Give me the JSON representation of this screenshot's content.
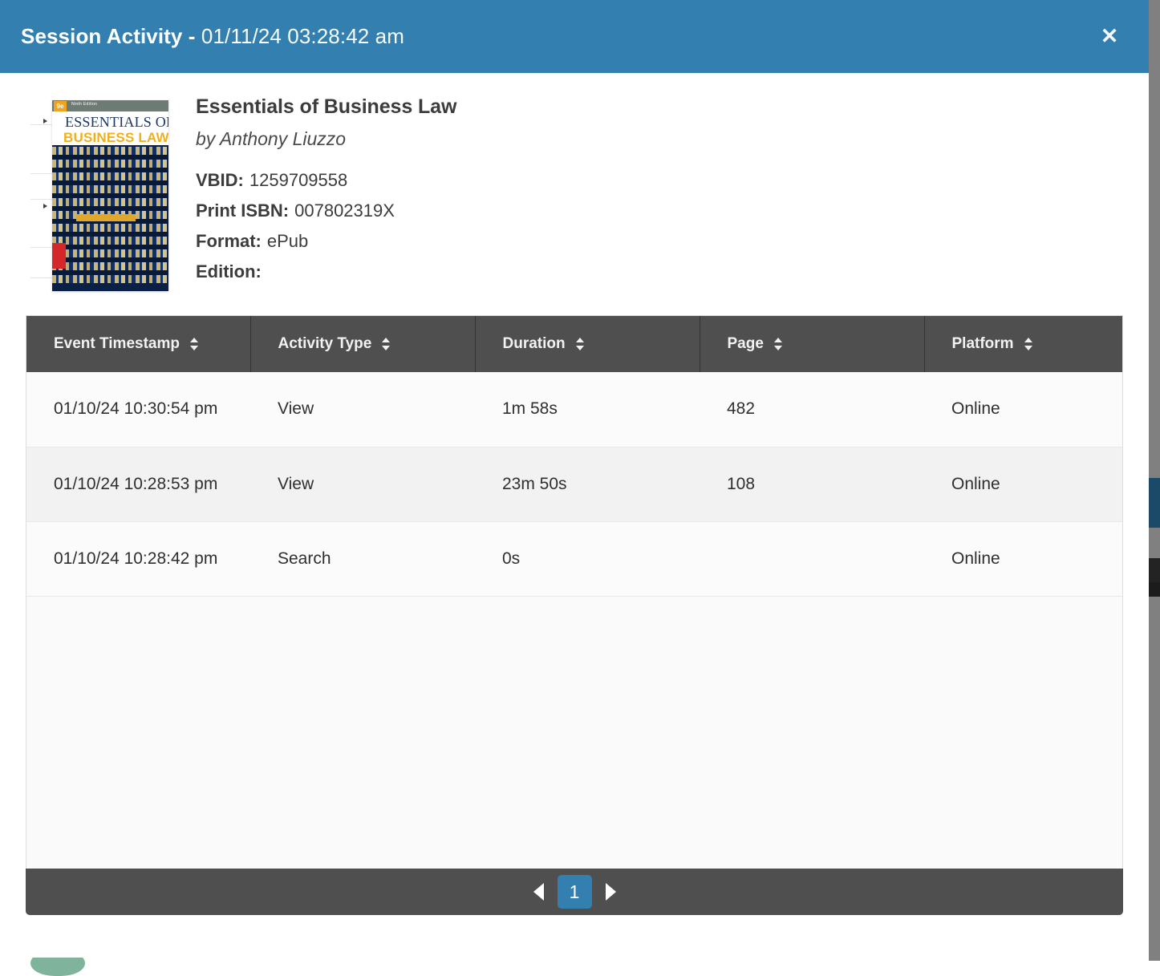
{
  "header": {
    "title_strong": "Session Activity - ",
    "title_light": "01/11/24 03:28:42 am",
    "close_label": "✕",
    "accent_color": "#3380b0"
  },
  "book": {
    "title": "Essentials of Business Law",
    "author": "by Anthony Liuzzo",
    "cover": {
      "edition_badge": "9e",
      "edition_text": "Ninth Edition",
      "title_line1": "ESSENTIALS OF",
      "title_line2": "BUSINESS LAW"
    },
    "meta": [
      {
        "label": "VBID:",
        "value": "1259709558"
      },
      {
        "label": "Print ISBN:",
        "value": "007802319X"
      },
      {
        "label": "Format:",
        "value": "ePub"
      },
      {
        "label": "Edition:",
        "value": ""
      }
    ]
  },
  "table": {
    "columns": [
      {
        "label": "Event Timestamp",
        "sort": "sort-icon"
      },
      {
        "label": "Activity Type",
        "sort": "sort-icon"
      },
      {
        "label": "Duration",
        "sort": "sort-icon"
      },
      {
        "label": "Page",
        "sort": "sort-icon"
      },
      {
        "label": "Platform",
        "sort": "sort-icon"
      }
    ],
    "rows": [
      {
        "timestamp": "01/10/24 10:30:54 pm",
        "activity_type": "View",
        "duration": "1m 58s",
        "page": "482",
        "platform": "Online"
      },
      {
        "timestamp": "01/10/24 10:28:53 pm",
        "activity_type": "View",
        "duration": "23m 50s",
        "page": "108",
        "platform": "Online"
      },
      {
        "timestamp": "01/10/24 10:28:42 pm",
        "activity_type": "Search",
        "duration": "0s",
        "page": "",
        "platform": "Online"
      }
    ]
  },
  "pagination": {
    "prev_label": "◀",
    "next_label": "▶",
    "current_page": "1"
  }
}
